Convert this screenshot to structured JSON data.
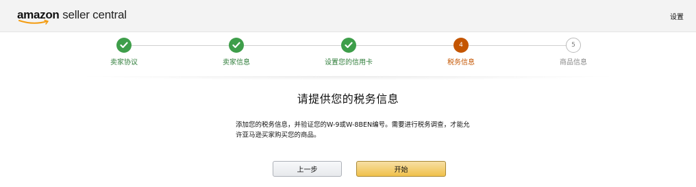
{
  "header": {
    "logo_brand": "amazon",
    "logo_product": "seller central",
    "settings_label": "设置"
  },
  "stepper": {
    "steps": [
      {
        "label": "卖家协议",
        "number": "1",
        "state": "done"
      },
      {
        "label": "卖家信息",
        "number": "2",
        "state": "done"
      },
      {
        "label": "设置您的信用卡",
        "number": "3",
        "state": "done"
      },
      {
        "label": "税务信息",
        "number": "4",
        "state": "active"
      },
      {
        "label": "商品信息",
        "number": "5",
        "state": "pending"
      }
    ]
  },
  "main": {
    "title": "请提供您的税务信息",
    "description": "添加您的税务信息，并验证您的W-9或W-8BEN编号。需要进行税务调查，才能允许亚马逊买家购买您的商品。"
  },
  "actions": {
    "back_label": "上一步",
    "start_label": "开始"
  },
  "colors": {
    "done": "#3e9e4a",
    "active": "#c45500",
    "primary_button": "#f0c14b"
  }
}
